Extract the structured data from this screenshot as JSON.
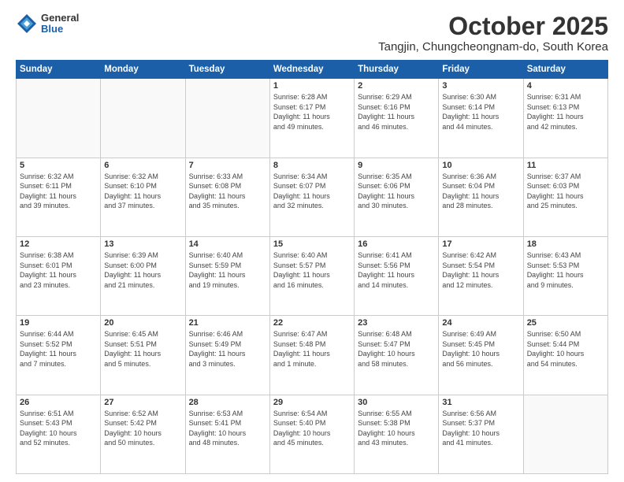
{
  "logo": {
    "general": "General",
    "blue": "Blue"
  },
  "title": "October 2025",
  "subtitle": "Tangjin, Chungcheongnam-do, South Korea",
  "headers": [
    "Sunday",
    "Monday",
    "Tuesday",
    "Wednesday",
    "Thursday",
    "Friday",
    "Saturday"
  ],
  "weeks": [
    [
      {
        "day": "",
        "info": ""
      },
      {
        "day": "",
        "info": ""
      },
      {
        "day": "",
        "info": ""
      },
      {
        "day": "1",
        "info": "Sunrise: 6:28 AM\nSunset: 6:17 PM\nDaylight: 11 hours\nand 49 minutes."
      },
      {
        "day": "2",
        "info": "Sunrise: 6:29 AM\nSunset: 6:16 PM\nDaylight: 11 hours\nand 46 minutes."
      },
      {
        "day": "3",
        "info": "Sunrise: 6:30 AM\nSunset: 6:14 PM\nDaylight: 11 hours\nand 44 minutes."
      },
      {
        "day": "4",
        "info": "Sunrise: 6:31 AM\nSunset: 6:13 PM\nDaylight: 11 hours\nand 42 minutes."
      }
    ],
    [
      {
        "day": "5",
        "info": "Sunrise: 6:32 AM\nSunset: 6:11 PM\nDaylight: 11 hours\nand 39 minutes."
      },
      {
        "day": "6",
        "info": "Sunrise: 6:32 AM\nSunset: 6:10 PM\nDaylight: 11 hours\nand 37 minutes."
      },
      {
        "day": "7",
        "info": "Sunrise: 6:33 AM\nSunset: 6:08 PM\nDaylight: 11 hours\nand 35 minutes."
      },
      {
        "day": "8",
        "info": "Sunrise: 6:34 AM\nSunset: 6:07 PM\nDaylight: 11 hours\nand 32 minutes."
      },
      {
        "day": "9",
        "info": "Sunrise: 6:35 AM\nSunset: 6:06 PM\nDaylight: 11 hours\nand 30 minutes."
      },
      {
        "day": "10",
        "info": "Sunrise: 6:36 AM\nSunset: 6:04 PM\nDaylight: 11 hours\nand 28 minutes."
      },
      {
        "day": "11",
        "info": "Sunrise: 6:37 AM\nSunset: 6:03 PM\nDaylight: 11 hours\nand 25 minutes."
      }
    ],
    [
      {
        "day": "12",
        "info": "Sunrise: 6:38 AM\nSunset: 6:01 PM\nDaylight: 11 hours\nand 23 minutes."
      },
      {
        "day": "13",
        "info": "Sunrise: 6:39 AM\nSunset: 6:00 PM\nDaylight: 11 hours\nand 21 minutes."
      },
      {
        "day": "14",
        "info": "Sunrise: 6:40 AM\nSunset: 5:59 PM\nDaylight: 11 hours\nand 19 minutes."
      },
      {
        "day": "15",
        "info": "Sunrise: 6:40 AM\nSunset: 5:57 PM\nDaylight: 11 hours\nand 16 minutes."
      },
      {
        "day": "16",
        "info": "Sunrise: 6:41 AM\nSunset: 5:56 PM\nDaylight: 11 hours\nand 14 minutes."
      },
      {
        "day": "17",
        "info": "Sunrise: 6:42 AM\nSunset: 5:54 PM\nDaylight: 11 hours\nand 12 minutes."
      },
      {
        "day": "18",
        "info": "Sunrise: 6:43 AM\nSunset: 5:53 PM\nDaylight: 11 hours\nand 9 minutes."
      }
    ],
    [
      {
        "day": "19",
        "info": "Sunrise: 6:44 AM\nSunset: 5:52 PM\nDaylight: 11 hours\nand 7 minutes."
      },
      {
        "day": "20",
        "info": "Sunrise: 6:45 AM\nSunset: 5:51 PM\nDaylight: 11 hours\nand 5 minutes."
      },
      {
        "day": "21",
        "info": "Sunrise: 6:46 AM\nSunset: 5:49 PM\nDaylight: 11 hours\nand 3 minutes."
      },
      {
        "day": "22",
        "info": "Sunrise: 6:47 AM\nSunset: 5:48 PM\nDaylight: 11 hours\nand 1 minute."
      },
      {
        "day": "23",
        "info": "Sunrise: 6:48 AM\nSunset: 5:47 PM\nDaylight: 10 hours\nand 58 minutes."
      },
      {
        "day": "24",
        "info": "Sunrise: 6:49 AM\nSunset: 5:45 PM\nDaylight: 10 hours\nand 56 minutes."
      },
      {
        "day": "25",
        "info": "Sunrise: 6:50 AM\nSunset: 5:44 PM\nDaylight: 10 hours\nand 54 minutes."
      }
    ],
    [
      {
        "day": "26",
        "info": "Sunrise: 6:51 AM\nSunset: 5:43 PM\nDaylight: 10 hours\nand 52 minutes."
      },
      {
        "day": "27",
        "info": "Sunrise: 6:52 AM\nSunset: 5:42 PM\nDaylight: 10 hours\nand 50 minutes."
      },
      {
        "day": "28",
        "info": "Sunrise: 6:53 AM\nSunset: 5:41 PM\nDaylight: 10 hours\nand 48 minutes."
      },
      {
        "day": "29",
        "info": "Sunrise: 6:54 AM\nSunset: 5:40 PM\nDaylight: 10 hours\nand 45 minutes."
      },
      {
        "day": "30",
        "info": "Sunrise: 6:55 AM\nSunset: 5:38 PM\nDaylight: 10 hours\nand 43 minutes."
      },
      {
        "day": "31",
        "info": "Sunrise: 6:56 AM\nSunset: 5:37 PM\nDaylight: 10 hours\nand 41 minutes."
      },
      {
        "day": "",
        "info": ""
      }
    ]
  ]
}
